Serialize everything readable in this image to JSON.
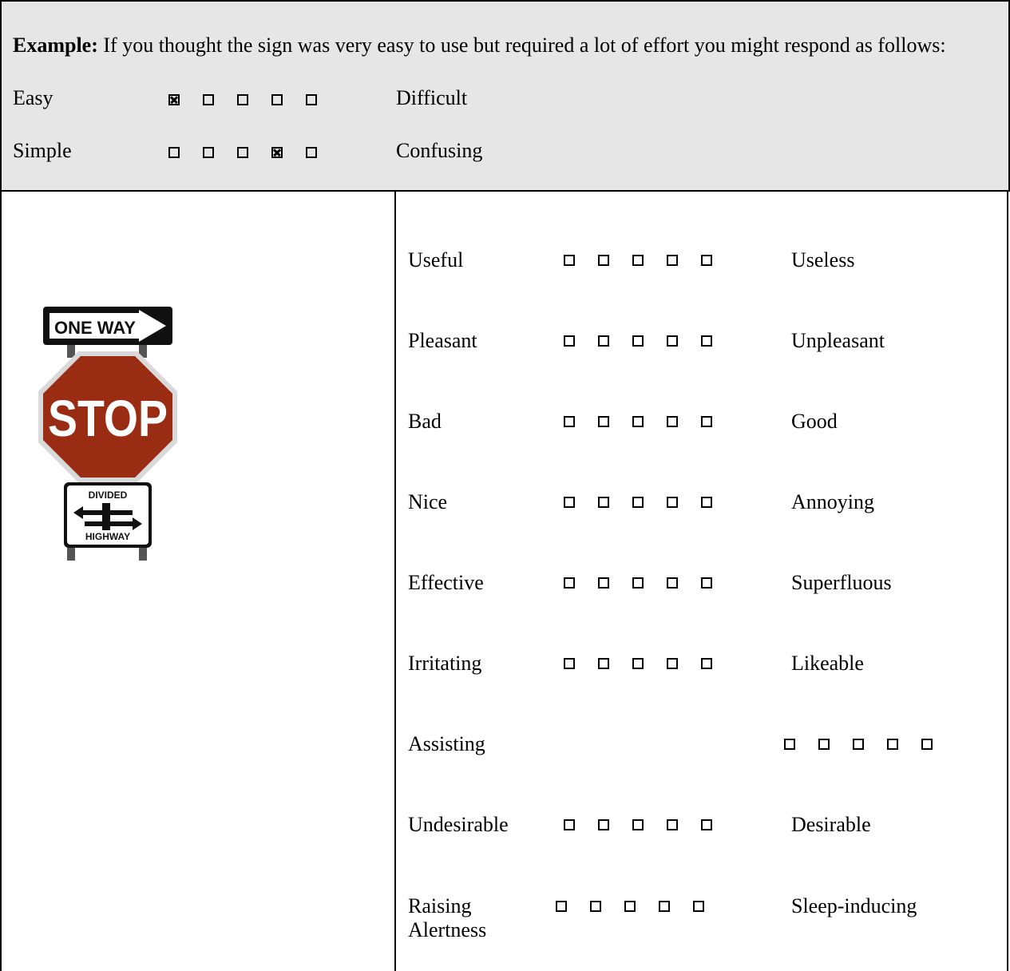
{
  "example": {
    "bold_label": "Example:",
    "text": " If you thought the sign was very easy to use but required a lot of effort you might respond as follows:",
    "rows": [
      {
        "left": "Easy",
        "right": "Difficult",
        "checked_index": 0
      },
      {
        "left": "Simple",
        "right": "Confusing",
        "checked_index": 3
      }
    ]
  },
  "sign": {
    "one_way": "ONE WAY",
    "stop": "STOP",
    "divided": "DIVIDED",
    "highway": "HIGHWAY",
    "stop_color": "#9b2c14"
  },
  "scales": [
    {
      "left": "Useful",
      "right": "Useless"
    },
    {
      "left": "Pleasant",
      "right": "Unpleasant"
    },
    {
      "left": "Bad",
      "right": "Good"
    },
    {
      "left": "Nice",
      "right": "Annoying"
    },
    {
      "left": "Effective",
      "right": "Superfluous"
    },
    {
      "left": "Irritating",
      "right": "Likeable"
    },
    {
      "left": "Assisting",
      "right": ""
    },
    {
      "left": "Undesirable",
      "right": "Desirable"
    },
    {
      "left": "Raising Alertness",
      "right": "Sleep-inducing"
    }
  ]
}
